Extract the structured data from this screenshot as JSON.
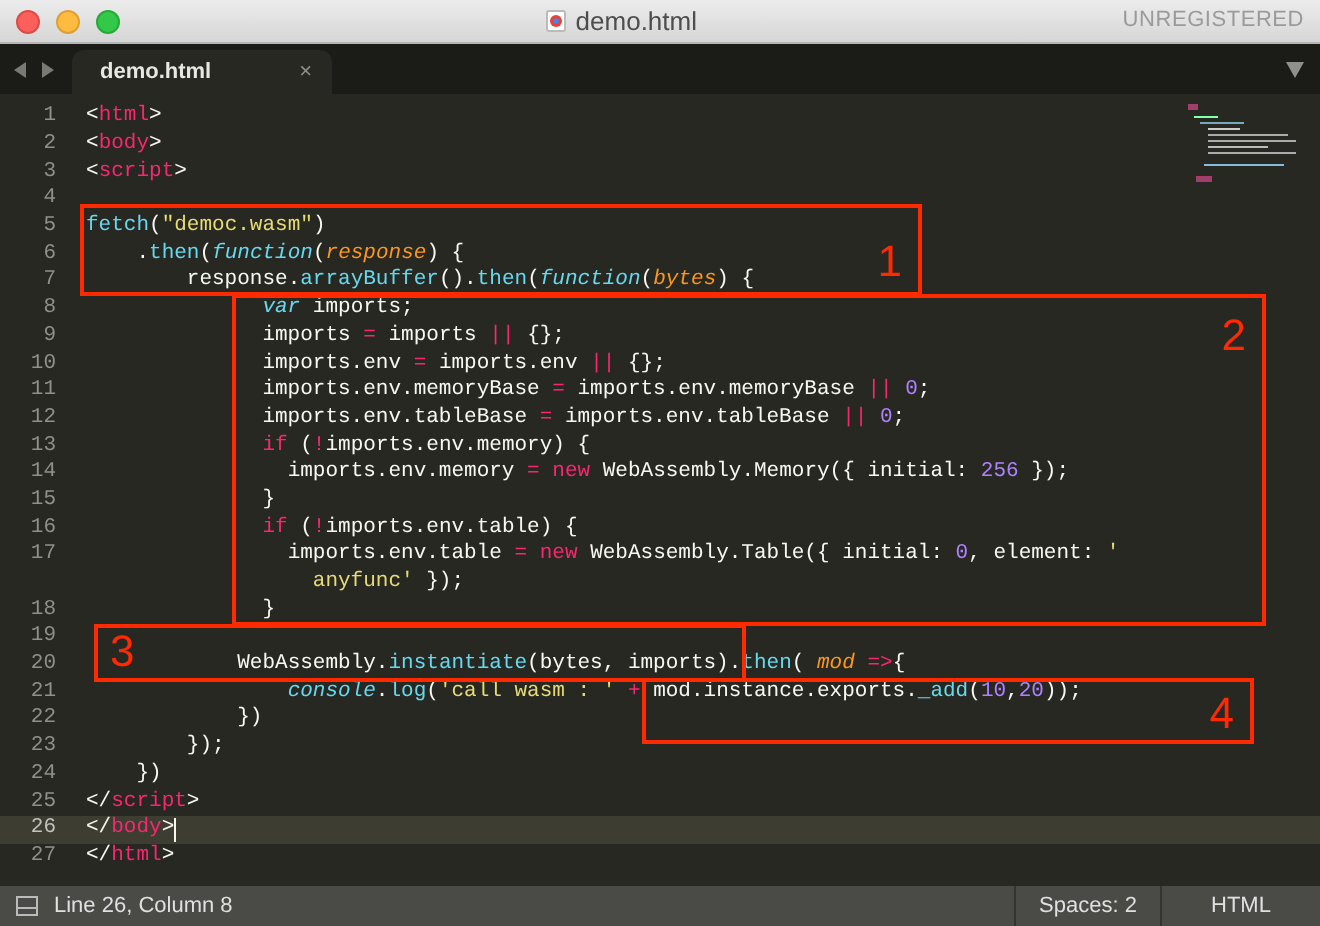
{
  "window": {
    "title": "demo.html",
    "badge": "UNREGISTERED"
  },
  "tabs": [
    {
      "label": "demo.html",
      "close": "×",
      "selected": true
    }
  ],
  "lines": [
    {
      "number": "1",
      "current": false,
      "tokens": [
        {
          "text": "<",
          "kind": "punct"
        },
        {
          "text": "html",
          "kind": "tag"
        },
        {
          "text": ">",
          "kind": "punct"
        }
      ]
    },
    {
      "number": "2",
      "current": false,
      "tokens": [
        {
          "text": "<",
          "kind": "punct"
        },
        {
          "text": "body",
          "kind": "tag"
        },
        {
          "text": ">",
          "kind": "punct"
        }
      ]
    },
    {
      "number": "3",
      "current": false,
      "tokens": [
        {
          "text": "<",
          "kind": "punct"
        },
        {
          "text": "script",
          "kind": "tag"
        },
        {
          "text": ">",
          "kind": "punct"
        }
      ]
    },
    {
      "number": "4",
      "current": false
    },
    {
      "number": "5",
      "current": false,
      "tokens": [
        {
          "text": "fetch",
          "kind": "fn"
        },
        {
          "text": "(",
          "kind": "punct"
        },
        {
          "text": "\"democ.wasm\"",
          "kind": "str"
        },
        {
          "text": ")",
          "kind": "punct"
        }
      ]
    },
    {
      "number": "6",
      "current": false,
      "tokens": [
        {
          "text": ".",
          "kind": "punct"
        },
        {
          "text": "then",
          "kind": "fn"
        },
        {
          "text": "(",
          "kind": "punct"
        },
        {
          "text": "function",
          "kind": "storage"
        },
        {
          "text": "(",
          "kind": "punct"
        },
        {
          "text": "response",
          "kind": "param"
        },
        {
          "text": ") {",
          "kind": "punct"
        }
      ]
    },
    {
      "number": "7",
      "current": false,
      "tokens": [
        {
          "text": "response.",
          "kind": "punct"
        },
        {
          "text": "arrayBuffer",
          "kind": "fn"
        },
        {
          "text": "().",
          "kind": "punct"
        },
        {
          "text": "then",
          "kind": "fn"
        },
        {
          "text": "(",
          "kind": "punct"
        },
        {
          "text": "function",
          "kind": "storage"
        },
        {
          "text": "(",
          "kind": "punct"
        },
        {
          "text": "bytes",
          "kind": "param"
        },
        {
          "text": ") {",
          "kind": "punct"
        }
      ]
    },
    {
      "number": "8",
      "current": false,
      "tokens": [
        {
          "text": "var",
          "kind": "storage"
        },
        {
          "text": " imports;",
          "kind": "punct"
        }
      ]
    },
    {
      "number": "9",
      "current": false,
      "tokens": [
        {
          "text": "imports ",
          "kind": "punct"
        },
        {
          "text": "=",
          "kind": "op"
        },
        {
          "text": " imports ",
          "kind": "punct"
        },
        {
          "text": "||",
          "kind": "op"
        },
        {
          "text": " {};",
          "kind": "punct"
        }
      ]
    },
    {
      "number": "10",
      "current": false,
      "tokens": [
        {
          "text": "imports.env ",
          "kind": "punct"
        },
        {
          "text": "=",
          "kind": "op"
        },
        {
          "text": " imports.env ",
          "kind": "punct"
        },
        {
          "text": "||",
          "kind": "op"
        },
        {
          "text": " {};",
          "kind": "punct"
        }
      ]
    },
    {
      "number": "11",
      "current": false,
      "tokens": [
        {
          "text": "imports.env.memoryBase ",
          "kind": "punct"
        },
        {
          "text": "=",
          "kind": "op"
        },
        {
          "text": " imports.env.memoryBase ",
          "kind": "punct"
        },
        {
          "text": "||",
          "kind": "op"
        },
        {
          "text": " 0",
          "kind": "num"
        },
        {
          "text": ";",
          "kind": "punct"
        }
      ]
    },
    {
      "number": "12",
      "current": false,
      "tokens": [
        {
          "text": "imports.env.tableBase ",
          "kind": "punct"
        },
        {
          "text": "=",
          "kind": "op"
        },
        {
          "text": " imports.env.tableBase ",
          "kind": "punct"
        },
        {
          "text": "||",
          "kind": "op"
        },
        {
          "text": " 0",
          "kind": "num"
        },
        {
          "text": ";",
          "kind": "punct"
        }
      ]
    },
    {
      "number": "13",
      "current": false,
      "tokens": [
        {
          "text": "if",
          "kind": "op"
        },
        {
          "text": " (",
          "kind": "punct"
        },
        {
          "text": "!",
          "kind": "op"
        },
        {
          "text": "imports.env.memory) {",
          "kind": "punct"
        }
      ]
    },
    {
      "number": "14",
      "current": false,
      "tokens": [
        {
          "text": "imports.env.memory ",
          "kind": "punct"
        },
        {
          "text": "=",
          "kind": "op"
        },
        {
          "text": " new",
          "kind": "op"
        },
        {
          "text": " WebAssembly.Memory({ initial: ",
          "kind": "punct"
        },
        {
          "text": "256",
          "kind": "num"
        },
        {
          "text": " });",
          "kind": "punct"
        }
      ]
    },
    {
      "number": "15",
      "current": false,
      "tokens": [
        {
          "text": "}",
          "kind": "punct"
        }
      ]
    },
    {
      "number": "16",
      "current": false,
      "tokens": [
        {
          "text": "if",
          "kind": "op"
        },
        {
          "text": " (",
          "kind": "punct"
        },
        {
          "text": "!",
          "kind": "op"
        },
        {
          "text": "imports.env.table) {",
          "kind": "punct"
        }
      ]
    },
    {
      "number": "17",
      "current": false,
      "tokens": [
        {
          "text": "imports.env.table ",
          "kind": "punct"
        },
        {
          "text": "=",
          "kind": "op"
        },
        {
          "text": " new",
          "kind": "op"
        },
        {
          "text": " WebAssembly.Table({ initial: ",
          "kind": "punct"
        },
        {
          "text": "0",
          "kind": "num"
        },
        {
          "text": ", element: ",
          "kind": "punct"
        },
        {
          "text": "'",
          "kind": "str"
        }
      ],
      "continuation": [
        {
          "text": "anyfunc'",
          "kind": "str"
        },
        {
          "text": " });",
          "kind": "punct"
        }
      ]
    },
    {
      "number": "18",
      "current": false,
      "tokens": [
        {
          "text": "}",
          "kind": "punct"
        }
      ]
    },
    {
      "number": "19",
      "current": false
    },
    {
      "number": "20",
      "current": false,
      "tokens": [
        {
          "text": "WebAssembly.",
          "kind": "punct"
        },
        {
          "text": "instantiate",
          "kind": "fn"
        },
        {
          "text": "(bytes, imports).",
          "kind": "punct"
        },
        {
          "text": "then",
          "kind": "fn"
        },
        {
          "text": "( ",
          "kind": "punct"
        },
        {
          "text": "mod",
          "kind": "param"
        },
        {
          "text": " =>",
          "kind": "op"
        },
        {
          "text": "{",
          "kind": "punct"
        }
      ]
    },
    {
      "number": "21",
      "current": false,
      "tokens": [
        {
          "text": "console",
          "kind": "storage"
        },
        {
          "text": ".",
          "kind": "punct"
        },
        {
          "text": "log",
          "kind": "fn"
        },
        {
          "text": "(",
          "kind": "punct"
        },
        {
          "text": "'call wasm : '",
          "kind": "str"
        },
        {
          "text": " +",
          "kind": "op"
        },
        {
          "text": " mod.instance.exports.",
          "kind": "punct"
        },
        {
          "text": "_add",
          "kind": "fn"
        },
        {
          "text": "(",
          "kind": "punct"
        },
        {
          "text": "10",
          "kind": "num"
        },
        {
          "text": ",",
          "kind": "punct"
        },
        {
          "text": "20",
          "kind": "num"
        },
        {
          "text": "));",
          "kind": "punct"
        }
      ]
    },
    {
      "number": "22",
      "current": false,
      "tokens": [
        {
          "text": "})",
          "kind": "punct"
        }
      ]
    },
    {
      "number": "23",
      "current": false,
      "tokens": [
        {
          "text": "});",
          "kind": "punct"
        }
      ]
    },
    {
      "number": "24",
      "current": false,
      "tokens": [
        {
          "text": "})",
          "kind": "punct"
        }
      ]
    },
    {
      "number": "25",
      "current": false,
      "tokens": [
        {
          "text": "</",
          "kind": "punct"
        },
        {
          "text": "script",
          "kind": "tag"
        },
        {
          "text": ">",
          "kind": "punct"
        }
      ]
    },
    {
      "number": "26",
      "current": true,
      "tokens": [
        {
          "text": "</",
          "kind": "punct"
        },
        {
          "text": "body",
          "kind": "tag"
        },
        {
          "text": ">",
          "kind": "punct"
        }
      ]
    },
    {
      "number": "27",
      "current": false,
      "tokens": [
        {
          "text": "</",
          "kind": "punct"
        },
        {
          "text": "html",
          "kind": "tag"
        },
        {
          "text": ">",
          "kind": "punct"
        }
      ]
    }
  ],
  "annotations": [
    {
      "label": "1"
    },
    {
      "label": "2"
    },
    {
      "label": "3"
    },
    {
      "label": "4"
    }
  ],
  "status_bar": {
    "position": "Line 26, Column 8",
    "indentation": "Spaces: 2",
    "syntax": "HTML"
  }
}
